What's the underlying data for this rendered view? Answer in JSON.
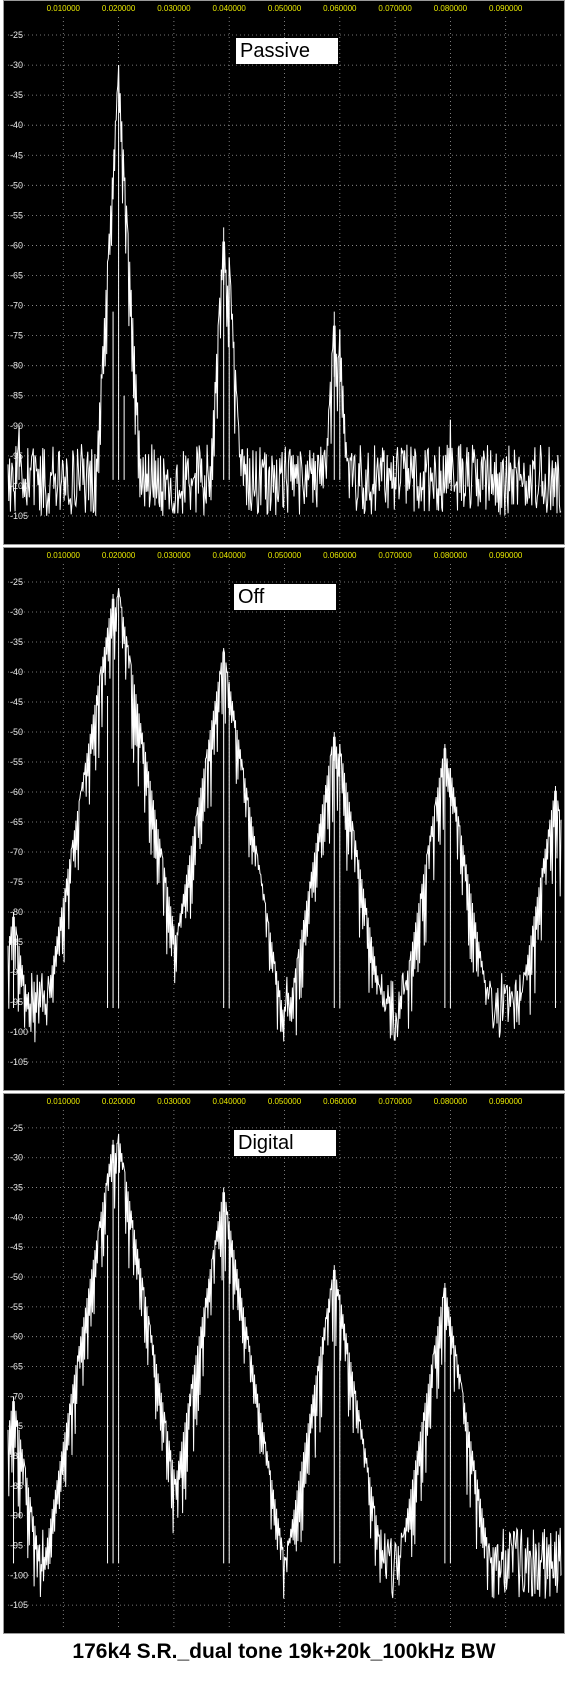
{
  "caption": "176k4 S.R._dual tone 19k+20k_100kHz BW",
  "colors": {
    "background": "#000000",
    "trace": "#ffffff",
    "x_tick_text": "#e8e800",
    "y_tick_text": "#e8e8e8",
    "grid": "#9a9a9a"
  },
  "chart_data": [
    {
      "type": "line",
      "label": "Passive",
      "x_tick_labels": [
        "0.010000",
        "0.020000",
        "0.030000",
        "0.040000",
        "0.050000",
        "0.060000",
        "0.070000",
        "0.080000",
        "0.090000"
      ],
      "y_tick_labels": [
        "-25",
        "-30",
        "-35",
        "-40",
        "-45",
        "-50",
        "-55",
        "-60",
        "-65",
        "-70",
        "-75",
        "-80",
        "-85",
        "-90",
        "-95",
        "-100",
        "-105"
      ],
      "xlim": [
        0,
        0.1
      ],
      "ylim": [
        -109,
        -22
      ],
      "grid": true,
      "noise_floor": -99,
      "peaks": [
        {
          "x": 0.019,
          "y": -71
        },
        {
          "x": 0.02,
          "y": -30
        },
        {
          "x": 0.021,
          "y": -85
        },
        {
          "x": 0.039,
          "y": -57
        },
        {
          "x": 0.04,
          "y": -62
        },
        {
          "x": 0.059,
          "y": -71
        },
        {
          "x": 0.06,
          "y": -74
        },
        {
          "x": 0.08,
          "y": -89
        },
        {
          "x": 0.002,
          "y": -90
        }
      ]
    },
    {
      "type": "line",
      "label": "Off",
      "x_tick_labels": [
        "0.010000",
        "0.020000",
        "0.030000",
        "0.040000",
        "0.050000",
        "0.060000",
        "0.070000",
        "0.080000",
        "0.090000"
      ],
      "y_tick_labels": [
        "-25",
        "-30",
        "-35",
        "-40",
        "-45",
        "-50",
        "-55",
        "-60",
        "-65",
        "-70",
        "-75",
        "-80",
        "-85",
        "-90",
        "-95",
        "-100",
        "-105"
      ],
      "xlim": [
        0,
        0.1
      ],
      "ylim": [
        -109,
        -22
      ],
      "grid": true,
      "noise_floor": -96,
      "peaks": [
        {
          "x": 0.019,
          "y": -27
        },
        {
          "x": 0.02,
          "y": -26
        },
        {
          "x": 0.018,
          "y": -44
        },
        {
          "x": 0.039,
          "y": -36
        },
        {
          "x": 0.04,
          "y": -42
        },
        {
          "x": 0.059,
          "y": -50
        },
        {
          "x": 0.06,
          "y": -52
        },
        {
          "x": 0.079,
          "y": -52
        },
        {
          "x": 0.08,
          "y": -56
        },
        {
          "x": 0.099,
          "y": -59
        },
        {
          "x": 0.001,
          "y": -80
        }
      ]
    },
    {
      "type": "line",
      "label": "Digital",
      "x_tick_labels": [
        "0.010000",
        "0.020000",
        "0.030000",
        "0.040000",
        "0.050000",
        "0.060000",
        "0.070000",
        "0.080000",
        "0.090000"
      ],
      "y_tick_labels": [
        "-25",
        "-30",
        "-35",
        "-40",
        "-45",
        "-50",
        "-55",
        "-60",
        "-65",
        "-70",
        "-75",
        "-80",
        "-85",
        "-90",
        "-95",
        "-100",
        "-105"
      ],
      "xlim": [
        0,
        0.1
      ],
      "ylim": [
        -109,
        -22
      ],
      "grid": true,
      "noise_floor": -98,
      "peaks": [
        {
          "x": 0.019,
          "y": -27
        },
        {
          "x": 0.02,
          "y": -26
        },
        {
          "x": 0.018,
          "y": -43
        },
        {
          "x": 0.039,
          "y": -35
        },
        {
          "x": 0.04,
          "y": -42
        },
        {
          "x": 0.059,
          "y": -48
        },
        {
          "x": 0.06,
          "y": -53
        },
        {
          "x": 0.079,
          "y": -51
        },
        {
          "x": 0.08,
          "y": -58
        },
        {
          "x": 0.001,
          "y": -70
        }
      ]
    }
  ]
}
